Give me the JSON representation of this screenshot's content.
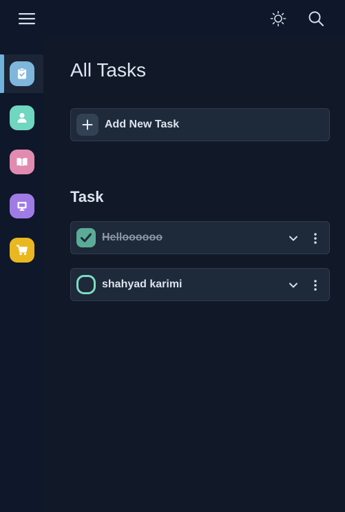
{
  "header": {
    "menu_icon": "hamburger-menu-icon",
    "theme_icon": "sun-icon",
    "search_icon": "search-icon"
  },
  "sidebar": {
    "items": [
      {
        "icon": "clipboard-check-icon",
        "color": "#7fb6dc",
        "active": true
      },
      {
        "icon": "user-icon",
        "color": "#6fd6bf",
        "active": false
      },
      {
        "icon": "book-open-icon",
        "color": "#e28bb0",
        "active": false
      },
      {
        "icon": "monitor-icon",
        "color": "#a07be6",
        "active": false
      },
      {
        "icon": "shopping-cart-icon",
        "color": "#e9b820",
        "active": false
      }
    ],
    "active_indicator_color": "#6fb3de"
  },
  "main": {
    "title": "All Tasks",
    "add_task_label": "Add New Task",
    "section_title": "Task",
    "tasks": [
      {
        "label": "Helloooooo",
        "completed": true
      },
      {
        "label": "shahyad karimi",
        "completed": false
      }
    ]
  },
  "colors": {
    "background": "#111827",
    "panel": "#1e2939",
    "done_check": "#5bab96",
    "todo_ring": "#7cdcc3"
  }
}
